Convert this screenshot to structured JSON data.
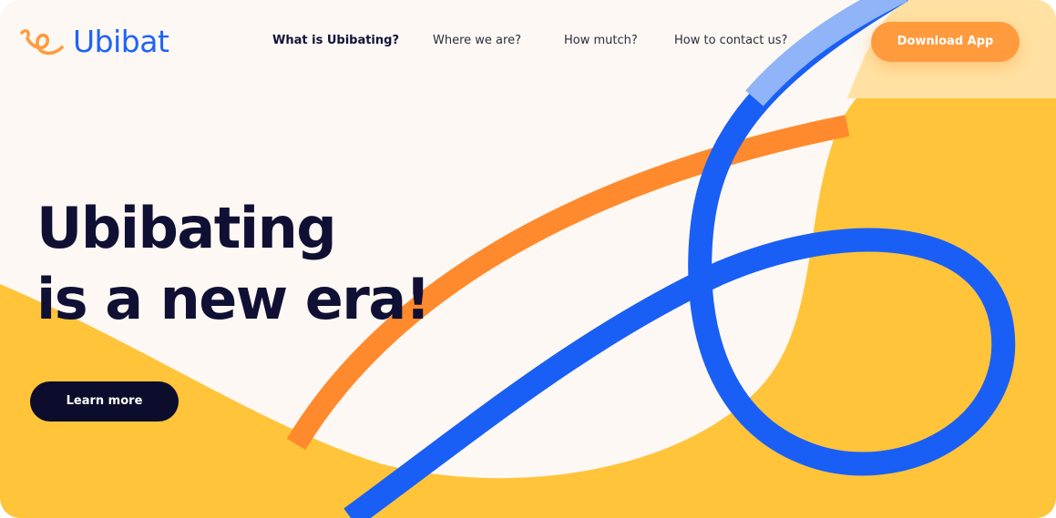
{
  "brand": {
    "name": "Ubibat",
    "logo_icon": "swirl-e-logo-icon",
    "color_primary": "#1f64f5",
    "color_accent": "#ff8a2d",
    "color_yellow": "#ffc43a",
    "color_dark": "#0f1033"
  },
  "nav": {
    "links": [
      {
        "label": "What is Ubibating?",
        "active": true
      },
      {
        "label": "Where we are?",
        "active": false
      },
      {
        "label": "How mutch?",
        "active": false
      },
      {
        "label": "How to contact us?",
        "active": false
      }
    ],
    "cta_label": "Download App"
  },
  "hero": {
    "title_line1": "Ubibating",
    "title_line2": "is a new era!",
    "button_label": "Learn more"
  }
}
